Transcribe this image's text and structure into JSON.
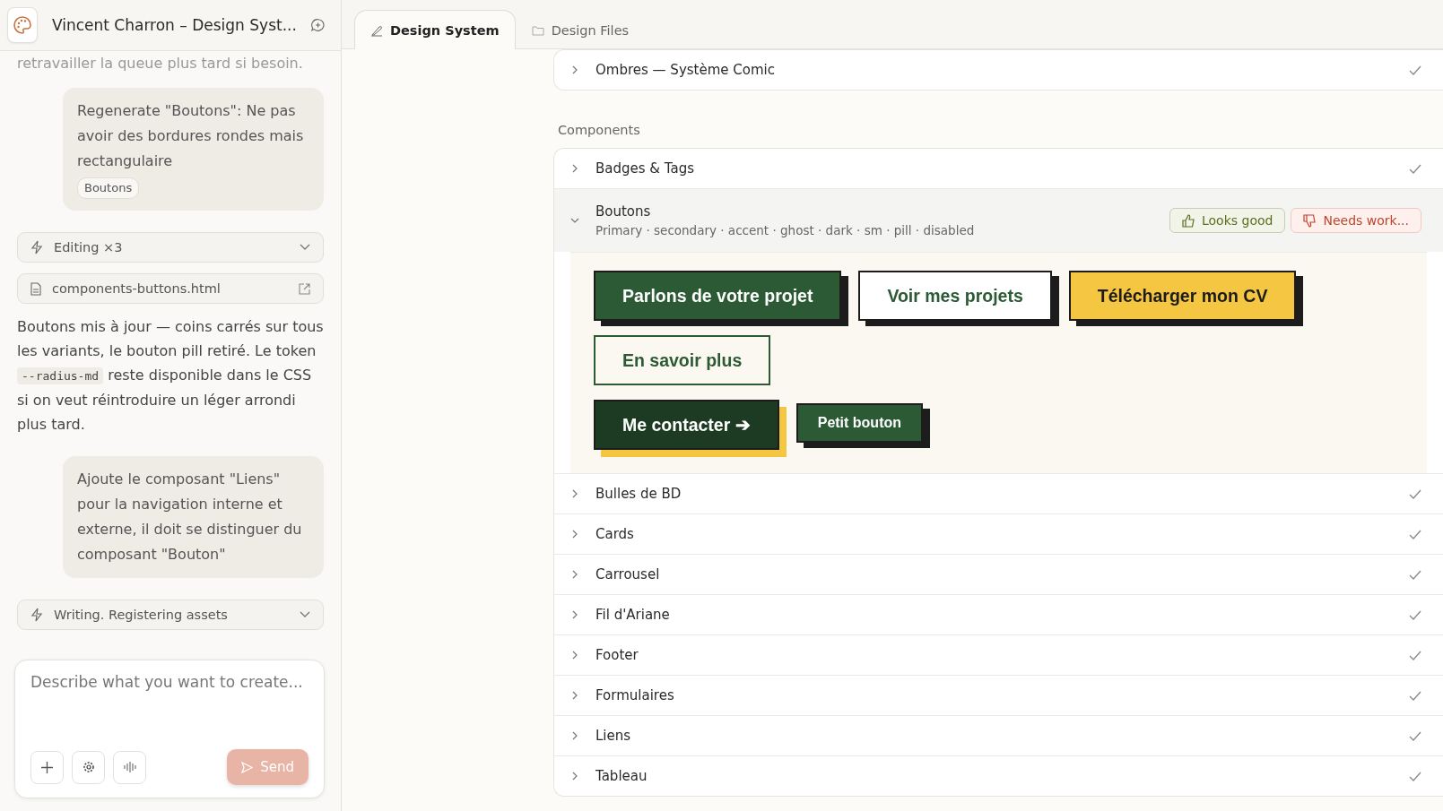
{
  "sidebar": {
    "title": "Vincent Charron – Design Syst...",
    "messages": [
      {
        "kind": "faded",
        "text": "retravailler la queue plus tard si besoin."
      },
      {
        "kind": "user",
        "text": "Regenerate \"Boutons\": Ne pas avoir des bordures rondes mais rectangulaire",
        "tag": "Boutons"
      },
      {
        "kind": "activity",
        "text": "Editing ×3"
      },
      {
        "kind": "file",
        "text": "components-buttons.html"
      },
      {
        "kind": "assistant",
        "parts": [
          "Boutons mis à jour — coins carrés sur tous les variants, le bouton pill retiré. Le token ",
          "--radius-md",
          " reste disponible dans le CSS si on veut réintroduire un léger arrondi plus tard."
        ]
      },
      {
        "kind": "user",
        "text": "Ajoute le composant \"Liens\" pour la navigation interne et externe, il doit se distinguer du composant \"Bouton\""
      },
      {
        "kind": "activity",
        "text": "Writing. Registering assets"
      }
    ],
    "composer": {
      "placeholder": "Describe what you want to create...",
      "send": "Send"
    }
  },
  "tabs": [
    {
      "label": "Design System",
      "selected": true
    },
    {
      "label": "Design Files",
      "selected": false
    }
  ],
  "groups": [
    {
      "items": [
        {
          "name": "Ombres — Système Comic",
          "checked": true,
          "expanded": false
        }
      ]
    },
    {
      "label": "Components",
      "items": [
        {
          "name": "Badges & Tags",
          "checked": true,
          "expanded": false
        },
        {
          "name": "Boutons",
          "checked": false,
          "expanded": true,
          "subtitle": "Primary · secondary · accent · ghost · dark · sm · pill · disabled",
          "feedback": [
            "Looks good",
            "Needs work..."
          ],
          "preview": [
            [
              {
                "kind": "primary",
                "label": "Parlons de votre projet"
              },
              {
                "kind": "secondary",
                "label": "Voir mes projets"
              },
              {
                "kind": "accent",
                "label": "Télécharger mon CV"
              }
            ],
            [
              {
                "kind": "ghost",
                "label": "En savoir plus"
              }
            ],
            [
              {
                "kind": "dark",
                "label": "Me contacter ➔"
              },
              {
                "kind": "sm",
                "label": "Petit bouton"
              }
            ]
          ]
        },
        {
          "name": "Bulles de BD",
          "checked": true,
          "expanded": false
        },
        {
          "name": "Cards",
          "checked": true,
          "expanded": false
        },
        {
          "name": "Carrousel",
          "checked": true,
          "expanded": false
        },
        {
          "name": "Fil d'Ariane",
          "checked": true,
          "expanded": false
        },
        {
          "name": "Footer",
          "checked": true,
          "expanded": false
        },
        {
          "name": "Formulaires",
          "checked": true,
          "expanded": false
        },
        {
          "name": "Liens",
          "checked": true,
          "expanded": false
        },
        {
          "name": "Tableau",
          "checked": true,
          "expanded": false
        }
      ]
    }
  ]
}
